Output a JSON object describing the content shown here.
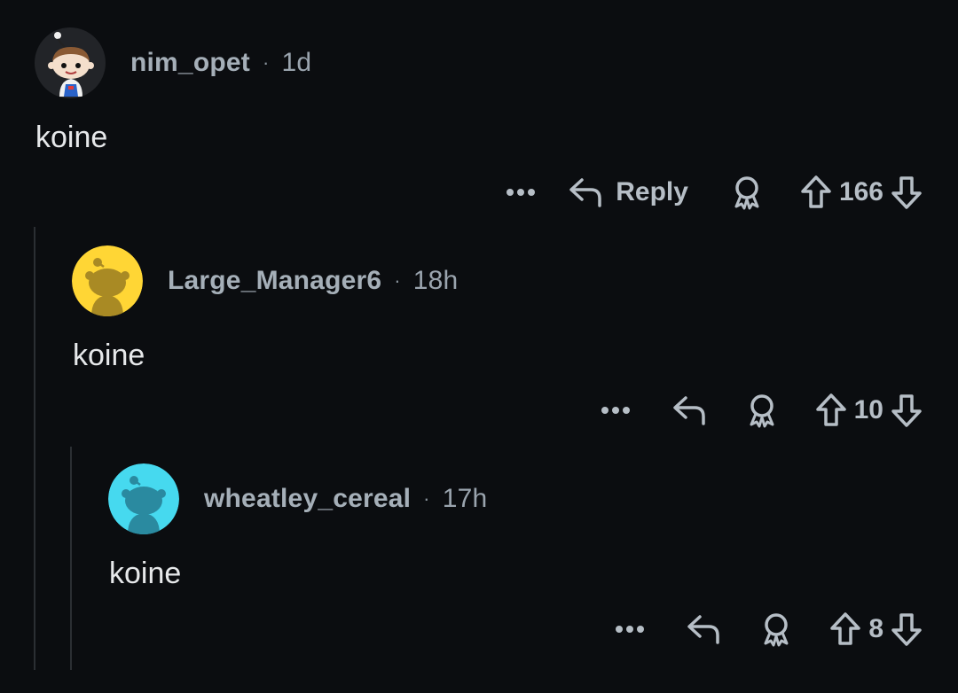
{
  "comments": [
    {
      "username": "nim_opet",
      "separator": "·",
      "age": "1d",
      "body": "koine",
      "reply_label": "Reply",
      "score": "166",
      "avatar": "snoo-custom-avatar"
    },
    {
      "username": "Large_Manager6",
      "separator": "·",
      "age": "18h",
      "body": "koine",
      "reply_label": "",
      "score": "10",
      "avatar": "snoo-default-yellow"
    },
    {
      "username": "wheatley_cereal",
      "separator": "·",
      "age": "17h",
      "body": "koine",
      "reply_label": "",
      "score": "8",
      "avatar": "snoo-default-cyan"
    }
  ],
  "icons": {
    "more": "more-options-icon",
    "reply": "reply-arrow-icon",
    "award": "award-icon",
    "upvote": "upvote-arrow-icon",
    "downvote": "downvote-arrow-icon"
  },
  "colors": {
    "background": "#0b0d10",
    "yellow_avatar": "#ffd635",
    "cyan_avatar": "#46d9ef",
    "thread_line": "#2b2f33"
  }
}
